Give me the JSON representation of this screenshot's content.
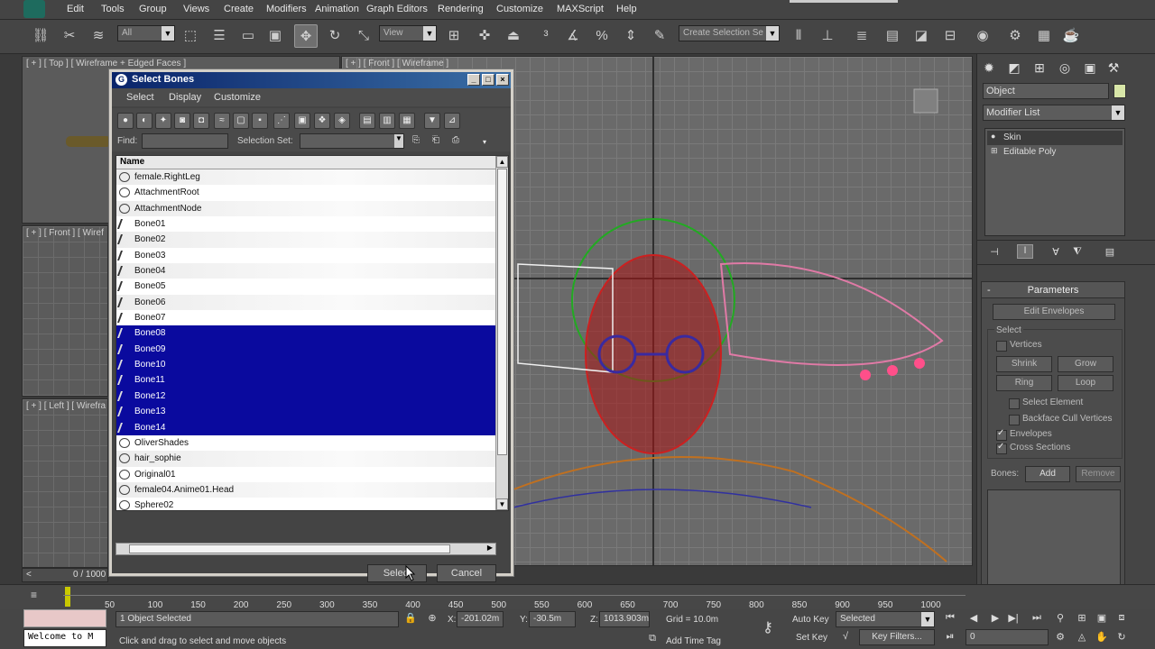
{
  "menu": [
    "Edit",
    "Tools",
    "Group",
    "Views",
    "Create",
    "Modifiers",
    "Animation",
    "Graph Editors",
    "Rendering",
    "Customize",
    "MAXScript",
    "Help"
  ],
  "toolbar": {
    "filter_value": "All",
    "coord_value": "View",
    "selection_set_placeholder": "Create Selection Se"
  },
  "viewports": {
    "top_label": "[ + ] [ Top ] [ Wireframe + Edged Faces ]",
    "front_small_label": "[ + ] [ Front ] [ Wiref",
    "left_label": "[ + ] [ Left ] [ Wirefra",
    "front_big_label": "[ + ] [ Front ] [ Wireframe ]",
    "frame_counter": "0 / 1000"
  },
  "dialog": {
    "title": "Select Bones",
    "menu": [
      "Select",
      "Display",
      "Customize"
    ],
    "find_label": "Find:",
    "selection_set_label": "Selection Set:",
    "column_name": "Name",
    "rows": [
      {
        "name": "female.RightLeg",
        "kind": "obj",
        "selected": false
      },
      {
        "name": "AttachmentRoot",
        "kind": "helper",
        "selected": false
      },
      {
        "name": "AttachmentNode",
        "kind": "helper",
        "selected": false
      },
      {
        "name": "Bone01",
        "kind": "bone",
        "selected": false
      },
      {
        "name": "Bone02",
        "kind": "bone",
        "selected": false
      },
      {
        "name": "Bone03",
        "kind": "bone",
        "selected": false
      },
      {
        "name": "Bone04",
        "kind": "bone",
        "selected": false
      },
      {
        "name": "Bone05",
        "kind": "bone",
        "selected": false
      },
      {
        "name": "Bone06",
        "kind": "bone",
        "selected": false
      },
      {
        "name": "Bone07",
        "kind": "bone",
        "selected": false
      },
      {
        "name": "Bone08",
        "kind": "bone",
        "selected": true
      },
      {
        "name": "Bone09",
        "kind": "bone",
        "selected": true
      },
      {
        "name": "Bone10",
        "kind": "bone",
        "selected": true
      },
      {
        "name": "Bone11",
        "kind": "bone",
        "selected": true
      },
      {
        "name": "Bone12",
        "kind": "bone",
        "selected": true
      },
      {
        "name": "Bone13",
        "kind": "bone",
        "selected": true
      },
      {
        "name": "Bone14",
        "kind": "bone",
        "selected": true
      },
      {
        "name": "OliverShades",
        "kind": "obj",
        "selected": false
      },
      {
        "name": "hair_sophie",
        "kind": "obj",
        "selected": false
      },
      {
        "name": "Original01",
        "kind": "obj",
        "selected": false
      },
      {
        "name": "female04.Anime01.Head",
        "kind": "obj",
        "selected": false
      },
      {
        "name": "Sphere02",
        "kind": "obj",
        "selected": false
      }
    ],
    "select_button": "Select",
    "cancel_button": "Cancel"
  },
  "command_panel": {
    "object_name": "Object",
    "modifier_list": "Modifier List",
    "stack": [
      "Skin",
      "Editable Poly"
    ],
    "parameters_title": "Parameters",
    "edit_envelopes": "Edit Envelopes",
    "select_group": "Select",
    "vertices": "Vertices",
    "shrink": "Shrink",
    "grow": "Grow",
    "ring": "Ring",
    "loop": "Loop",
    "select_element": "Select Element",
    "backface_cull": "Backface Cull Vertices",
    "envelopes": "Envelopes",
    "cross_sections": "Cross Sections",
    "bones_label": "Bones:",
    "add": "Add",
    "remove": "Remove"
  },
  "timeline": {
    "ticks": [
      "50",
      "100",
      "150",
      "200",
      "250",
      "300",
      "350",
      "400",
      "450",
      "500",
      "550",
      "600",
      "650",
      "700",
      "750",
      "800",
      "850",
      "900",
      "950",
      "1000"
    ]
  },
  "status": {
    "welcome": "Welcome to M",
    "selected": "1 Object Selected",
    "prompt": "Click and drag to select and move objects",
    "x_label": "X:",
    "x_value": "-201.02m",
    "y_label": "Y:",
    "y_value": "-30.5m",
    "z_label": "Z:",
    "z_value": "1013.903m",
    "grid": "Grid = 10.0m",
    "auto_key": "Auto Key",
    "selected_mode": "Selected",
    "set_key": "Set Key",
    "key_filters": "Key Filters...",
    "add_time_tag": "Add Time Tag",
    "frame_value": "0"
  },
  "colors": {
    "selection_highlight": "#0a0a9e",
    "dialog_title": "#0a246a"
  }
}
